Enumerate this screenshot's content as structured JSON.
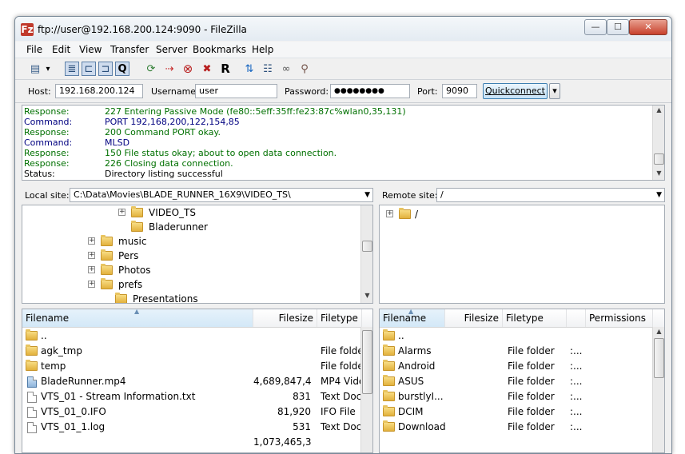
{
  "window": {
    "title": "ftp://user@192.168.200.124:9090 - FileZilla",
    "app_icon": "Fz",
    "min_glyph": "—",
    "max_glyph": "☐",
    "close_glyph": "✕"
  },
  "menu": [
    "File",
    "Edit",
    "View",
    "Transfer",
    "Server",
    "Bookmarks",
    "Help"
  ],
  "toolbar": {
    "icons": [
      {
        "name": "site-manager-icon",
        "glyph": "▤"
      },
      {
        "name": "dropdown-arrow-icon",
        "glyph": "▾"
      },
      {
        "name": "toggle-message-log-icon",
        "glyph": "≣"
      },
      {
        "name": "toggle-local-tree-icon",
        "glyph": "⊏"
      },
      {
        "name": "toggle-remote-tree-icon",
        "glyph": "⊐"
      },
      {
        "name": "toggle-queue-icon",
        "glyph": "Q"
      },
      {
        "name": "refresh-icon",
        "glyph": "⟳"
      },
      {
        "name": "process-queue-icon",
        "glyph": "⇢"
      },
      {
        "name": "cancel-icon",
        "glyph": "⊗"
      },
      {
        "name": "disconnect-icon",
        "glyph": "✖"
      },
      {
        "name": "reconnect-icon",
        "glyph": "R"
      },
      {
        "name": "directory-compare-icon",
        "glyph": "⇅"
      },
      {
        "name": "filter-icon",
        "glyph": "☷"
      },
      {
        "name": "sync-browsing-icon",
        "glyph": "∞"
      },
      {
        "name": "search-icon",
        "glyph": "⚲"
      }
    ]
  },
  "quickconnect": {
    "host_label": "Host:",
    "host_value": "192.168.200.124",
    "username_label": "Username:",
    "username_value": "user",
    "password_label": "Password:",
    "password_value": "●●●●●●●●",
    "port_label": "Port:",
    "port_value": "9090",
    "button_label": "Quickconnect",
    "dropdown_glyph": "▾"
  },
  "log": [
    {
      "label": "Response:",
      "msg": "227 Entering Passive Mode (fe80::5eff:35ff:fe23:87c%wlan0,35,131)",
      "color": "#007000"
    },
    {
      "label": "Command:",
      "msg": "PORT 192,168,200,122,154,85",
      "color": "#000080"
    },
    {
      "label": "Response:",
      "msg": "200 Command PORT okay.",
      "color": "#007000"
    },
    {
      "label": "Command:",
      "msg": "MLSD",
      "color": "#000080"
    },
    {
      "label": "Response:",
      "msg": "150 File status okay; about to open data connection.",
      "color": "#007000"
    },
    {
      "label": "Response:",
      "msg": "226 Closing data connection.",
      "color": "#007000"
    },
    {
      "label": "Status:",
      "msg": "Directory listing successful",
      "color": "#000000"
    }
  ],
  "local": {
    "site_label": "Local site:",
    "path": "C:\\Data\\Movies\\BLADE_RUNNER_16X9\\VIDEO_TS\\",
    "tree": [
      {
        "name": "VIDEO_TS",
        "expander": "+"
      },
      {
        "name": "Bladerunner",
        "expander": ""
      },
      {
        "name": "music",
        "expander": "+"
      },
      {
        "name": "Pers",
        "expander": "+"
      },
      {
        "name": "Photos",
        "expander": "+"
      },
      {
        "name": "prefs",
        "expander": "+"
      },
      {
        "name": "Presentations",
        "expander": ""
      }
    ],
    "columns": [
      "Filename",
      "Filesize",
      "Filetype"
    ],
    "files": [
      {
        "name": "..",
        "size": "",
        "type": "",
        "icon": "folder"
      },
      {
        "name": "agk_tmp",
        "size": "",
        "type": "File folder",
        "icon": "folder"
      },
      {
        "name": "temp",
        "size": "",
        "type": "File folder",
        "icon": "folder"
      },
      {
        "name": "BladeRunner.mp4",
        "size": "4,689,847,4...",
        "type": "MP4 Video",
        "icon": "media"
      },
      {
        "name": "VTS_01 - Stream Information.txt",
        "size": "831",
        "type": "Text Document",
        "icon": "doc"
      },
      {
        "name": "VTS_01_0.IFO",
        "size": "81,920",
        "type": "IFO File",
        "icon": "doc"
      },
      {
        "name": "VTS_01_1.log",
        "size": "531",
        "type": "Text Document",
        "icon": "doc"
      },
      {
        "name": "",
        "size": "1,073,465,3...",
        "type": "",
        "icon": "none"
      }
    ]
  },
  "remote": {
    "site_label": "Remote site:",
    "path": "/",
    "tree": [
      {
        "name": "/",
        "expander": "+"
      }
    ],
    "columns": [
      "Filename",
      "Filesize",
      "Filetype",
      "",
      "Permissions"
    ],
    "files": [
      {
        "name": "..",
        "type": "",
        "perm": ""
      },
      {
        "name": "Alarms",
        "type": "File folder",
        "perm": ":..."
      },
      {
        "name": "Android",
        "type": "File folder",
        "perm": ":..."
      },
      {
        "name": "ASUS",
        "type": "File folder",
        "perm": ":..."
      },
      {
        "name": "burstlyI...",
        "type": "File folder",
        "perm": ":..."
      },
      {
        "name": "DCIM",
        "type": "File folder",
        "perm": ":..."
      },
      {
        "name": "Download",
        "type": "File folder",
        "perm": ":..."
      }
    ]
  }
}
